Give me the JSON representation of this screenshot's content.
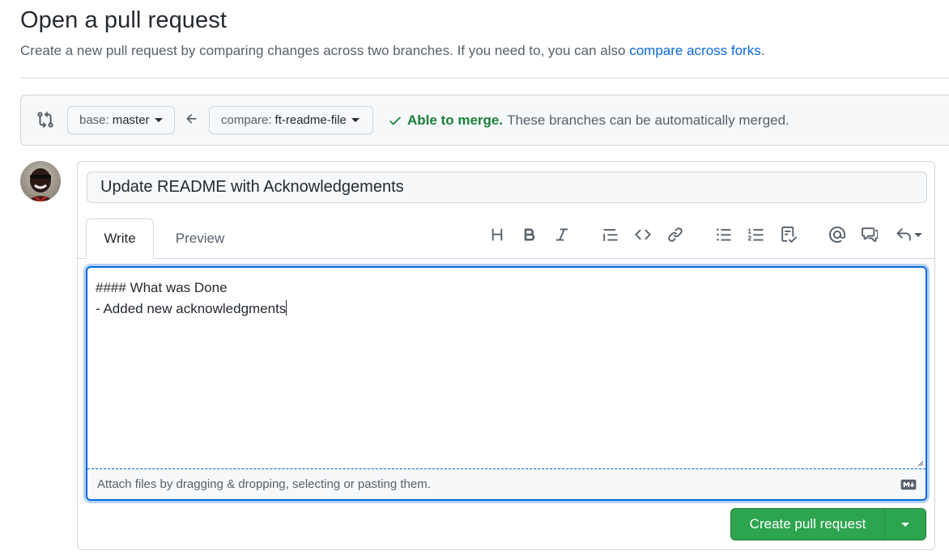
{
  "header": {
    "title": "Open a pull request",
    "subtitle": "Create a new pull request by comparing changes across two branches. If you need to, you can also ",
    "compare_link": "compare across forks",
    "subtitle_end": "."
  },
  "range": {
    "base_label": "base:",
    "base_value": "master",
    "compare_label": "compare:",
    "compare_value": "ft-readme-file",
    "merge_ok": "Able to merge.",
    "merge_message": "These branches can be automatically merged."
  },
  "composer": {
    "title_value": "Update README with Acknowledgements",
    "tabs": [
      "Write",
      "Preview"
    ],
    "body_line_1": "#### What was Done",
    "body_line_2": "- Added new acknowledgments",
    "attach_text": "Attach files by dragging & dropping, selecting or pasting them.",
    "submit_label": "Create pull request"
  },
  "toolbar_icons": [
    "heading-icon",
    "bold-icon",
    "italic-icon",
    "quote-icon",
    "code-icon",
    "link-icon",
    "unordered-list-icon",
    "ordered-list-icon",
    "task-list-icon",
    "mention-icon",
    "cross-reference-icon",
    "reply-icon"
  ],
  "colors": {
    "accent": "#0969da",
    "success": "#1a7f37",
    "button_green": "#2da44e"
  }
}
